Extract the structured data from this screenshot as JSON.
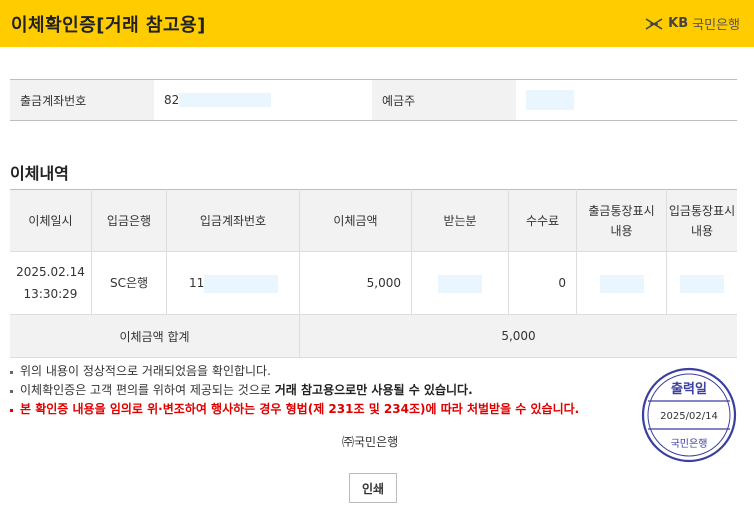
{
  "header": {
    "title": "이체확인증[거래 참고용]",
    "logo_text": "KB",
    "logo_bank": "국민은행"
  },
  "account": {
    "out_label": "출금계좌번호",
    "out_value": "82",
    "holder_label": "예금주",
    "holder_value": ""
  },
  "section_title": "이체내역",
  "transfer_table": {
    "headers": [
      "이체일시",
      "입금은행",
      "입금계좌번호",
      "이체금액",
      "받는분",
      "수수료",
      "출금통장표시\n내용",
      "입금통장표시\n내용"
    ],
    "row": {
      "date": "2025.02.14",
      "time": "13:30:29",
      "bank": "SC은행",
      "account": "11",
      "amount": "5,000",
      "recipient": "",
      "fee": "0",
      "out_memo": "",
      "in_memo": ""
    },
    "total_label": "이체금액 합계",
    "total_value": "5,000"
  },
  "notes": {
    "line1": "위의 내용이 정상적으로 거래되었음을 확인합니다.",
    "line2_prefix": "이체확인증은 고객 편의를 위하여 제공되는 것으로 ",
    "line2_bold": "거래 참고용으로만 사용될 수 있습니다.",
    "line3": "본 확인증 내용을 임의로 위·변조하여 행사하는 경우 형법(제 231조 및 234조)에 따라 처벌받을 수 있습니다."
  },
  "bank_signature": "㈜국민은행",
  "print_button": "인쇄",
  "stamp": {
    "top_text": "출력일",
    "date": "2025/02/14",
    "bottom_text": "국민은행"
  },
  "colors": {
    "header_bg": "#ffcc00",
    "stamp": "#3b3fa0",
    "warning": "#e00000",
    "masked": "#eaf6fd"
  }
}
